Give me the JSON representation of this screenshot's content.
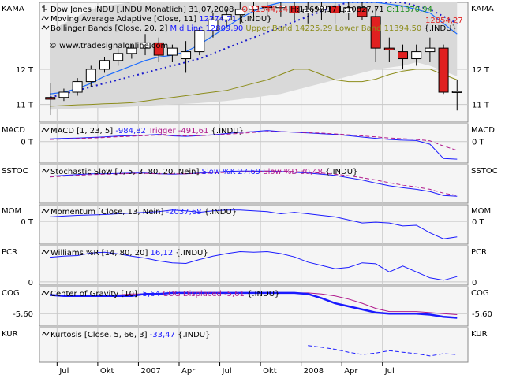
{
  "colors": {
    "bg": "#ffffff",
    "panel_bg": "#f5f5f5",
    "border": "#8a8a8a",
    "grid": "#c8c8c8",
    "band_fill": "#d9d9d9",
    "band_line": "#8c8c1a",
    "mid_line": "#1a1acc",
    "kama": "#1a6bff",
    "ma_adapt": "#1a1acc",
    "up_candle": "#ffffff",
    "down_candle": "#e02020",
    "blue": "#1a1aff",
    "purple": "#b01a8c",
    "green": "#1a8c1a",
    "red": "#e02020",
    "olive": "#8c8c1a",
    "dark": "#000000"
  },
  "chart_data": [
    {
      "id": "price",
      "type": "candlestick",
      "left_label": "KAMA",
      "right_label": "KAMA",
      "ylim": [
        10.5,
        13.9
      ],
      "yticks": [
        {
          "v": 11,
          "label": "11 T"
        },
        {
          "v": 12,
          "label": "12 T"
        }
      ],
      "legend": [
        {
          "icon": "ohlc",
          "parts": [
            {
              "t": "Dow Jones INDU [.INDU  Monatlich] 31,07,2008 - ",
              "c": "dark"
            },
            {
              "t": "O:11344,64",
              "c": "red"
            },
            {
              "t": " H:11698,17 L:10827,71 ",
              "c": "dark"
            },
            {
              "t": "C:11370,94",
              "c": "green"
            }
          ]
        },
        {
          "icon": "line",
          "parts": [
            {
              "t": "Moving Average Adaptive [Close, 11] ",
              "c": "dark"
            },
            {
              "t": "12774,71",
              "c": "blue"
            },
            {
              "t": " {.INDU}",
              "c": "dark"
            }
          ]
        },
        {
          "icon": "line",
          "parts": [
            {
              "t": "Bollinger Bands [Close, 20, 2] ",
              "c": "dark"
            },
            {
              "t": "Mid Line 12809,90",
              "c": "blue"
            },
            {
              "t": " Upper Band 14225,29 Lower Band 11394,50",
              "c": "olive"
            },
            {
              "t": " {.INDU}",
              "c": "dark"
            }
          ]
        }
      ],
      "watermark": "© www.tradesignalonline.com",
      "value_tag": "12854,27",
      "candles": [
        {
          "x": 0,
          "o": 11.2,
          "h": 11.6,
          "l": 10.7,
          "c": 11.15
        },
        {
          "x": 1,
          "o": 11.2,
          "h": 11.45,
          "l": 11.1,
          "c": 11.35
        },
        {
          "x": 2,
          "o": 11.35,
          "h": 11.75,
          "l": 11.25,
          "c": 11.65
        },
        {
          "x": 3,
          "o": 11.65,
          "h": 12.1,
          "l": 11.5,
          "c": 12.0
        },
        {
          "x": 4,
          "o": 12.0,
          "h": 12.35,
          "l": 11.9,
          "c": 12.25
        },
        {
          "x": 5,
          "o": 12.25,
          "h": 12.6,
          "l": 12.1,
          "c": 12.45
        },
        {
          "x": 6,
          "o": 12.45,
          "h": 12.7,
          "l": 12.3,
          "c": 12.6
        },
        {
          "x": 7,
          "o": 12.6,
          "h": 13.0,
          "l": 12.4,
          "c": 12.75
        },
        {
          "x": 8,
          "o": 12.75,
          "h": 12.9,
          "l": 12.2,
          "c": 12.4
        },
        {
          "x": 9,
          "o": 12.4,
          "h": 12.7,
          "l": 12.2,
          "c": 12.6
        },
        {
          "x": 10,
          "o": 12.3,
          "h": 12.8,
          "l": 11.9,
          "c": 12.5
        },
        {
          "x": 11,
          "o": 12.5,
          "h": 13.2,
          "l": 12.4,
          "c": 13.1
        },
        {
          "x": 12,
          "o": 13.1,
          "h": 13.6,
          "l": 12.9,
          "c": 13.4
        },
        {
          "x": 13,
          "o": 13.4,
          "h": 13.7,
          "l": 13.2,
          "c": 13.55
        },
        {
          "x": 14,
          "o": 13.55,
          "h": 13.9,
          "l": 13.3,
          "c": 13.7
        },
        {
          "x": 15,
          "o": 13.7,
          "h": 13.9,
          "l": 13.5,
          "c": 13.8
        },
        {
          "x": 16,
          "o": 13.8,
          "h": 13.9,
          "l": 13.5,
          "c": 13.75
        },
        {
          "x": 17,
          "o": 13.75,
          "h": 13.9,
          "l": 13.5,
          "c": 13.8
        },
        {
          "x": 18,
          "o": 13.8,
          "h": 13.9,
          "l": 13.4,
          "c": 13.6
        },
        {
          "x": 19,
          "o": 13.6,
          "h": 13.9,
          "l": 13.3,
          "c": 13.7
        },
        {
          "x": 20,
          "o": 13.7,
          "h": 13.9,
          "l": 13.4,
          "c": 13.8
        },
        {
          "x": 21,
          "o": 13.8,
          "h": 13.9,
          "l": 13.3,
          "c": 13.6
        },
        {
          "x": 22,
          "o": 13.6,
          "h": 13.9,
          "l": 13.4,
          "c": 13.75
        },
        {
          "x": 23,
          "o": 13.75,
          "h": 13.9,
          "l": 13.4,
          "c": 13.5
        },
        {
          "x": 24,
          "o": 13.5,
          "h": 13.8,
          "l": 12.2,
          "c": 12.6
        },
        {
          "x": 25,
          "o": 12.6,
          "h": 12.9,
          "l": 12.2,
          "c": 12.55
        },
        {
          "x": 26,
          "o": 12.5,
          "h": 12.7,
          "l": 12.0,
          "c": 12.3
        },
        {
          "x": 27,
          "o": 12.3,
          "h": 12.7,
          "l": 12.1,
          "c": 12.5
        },
        {
          "x": 28,
          "o": 12.5,
          "h": 12.9,
          "l": 12.2,
          "c": 12.6
        },
        {
          "x": 29,
          "o": 12.6,
          "h": 12.7,
          "l": 11.3,
          "c": 11.35
        },
        {
          "x": 30,
          "o": 11.34,
          "h": 11.7,
          "l": 10.83,
          "c": 11.37
        }
      ],
      "upper_band": [
        13.1,
        13.3,
        13.5,
        13.7,
        13.8,
        13.85,
        13.9,
        13.9,
        13.9,
        13.9,
        13.9,
        13.9,
        13.9,
        13.9,
        13.9,
        13.9,
        13.9,
        13.9,
        13.9,
        13.9,
        13.9,
        13.9,
        13.9,
        13.9,
        13.9,
        13.9,
        13.9,
        13.9,
        13.9,
        13.9,
        13.9
      ],
      "lower_band": [
        10.95,
        10.97,
        10.99,
        11.0,
        11.02,
        11.03,
        11.05,
        11.1,
        11.15,
        11.2,
        11.25,
        11.3,
        11.35,
        11.4,
        11.5,
        11.6,
        11.7,
        11.85,
        12.0,
        12.0,
        11.85,
        11.7,
        11.65,
        11.65,
        11.72,
        11.85,
        11.95,
        12.0,
        12.0,
        11.85,
        11.7
      ],
      "lower_band2": [
        10.85,
        10.87,
        10.88,
        10.9,
        10.9,
        10.92,
        10.94,
        10.96,
        10.98,
        11.0,
        11.02,
        11.04,
        11.07,
        11.1,
        11.15,
        11.2,
        11.25,
        11.3,
        11.4,
        11.5,
        11.6,
        11.7,
        11.8,
        11.9,
        12.0,
        12.05,
        12.1,
        12.2,
        12.1,
        11.95,
        11.8
      ],
      "mid_line": [
        11.2,
        11.3,
        11.4,
        11.5,
        11.6,
        11.7,
        11.8,
        11.9,
        12.0,
        12.1,
        12.2,
        12.3,
        12.45,
        12.6,
        12.75,
        12.9,
        13.05,
        13.2,
        13.35,
        13.5,
        13.65,
        13.8,
        13.9,
        13.9,
        13.9,
        13.9,
        13.9,
        13.8,
        13.7,
        13.5,
        13.3
      ],
      "kama": [
        11.3,
        11.35,
        11.45,
        11.6,
        11.8,
        11.95,
        12.1,
        12.25,
        12.35,
        12.4,
        12.5,
        12.7,
        12.95,
        13.2,
        13.45,
        13.65,
        13.8,
        13.9,
        13.9,
        13.9,
        13.9,
        13.9,
        13.9,
        13.9,
        13.9,
        13.85,
        13.8,
        13.7,
        13.6,
        13.3,
        13.0
      ]
    },
    {
      "id": "macd",
      "type": "line",
      "left_label": "MACD",
      "right_label": "MACD",
      "ylim": [
        -1200,
        1000
      ],
      "yticks": [
        {
          "v": 0,
          "label": "0 T"
        }
      ],
      "legend": [
        {
          "icon": "line",
          "parts": [
            {
              "t": "MACD [1, 23, 5] ",
              "c": "dark"
            },
            {
              "t": "-984,82",
              "c": "blue"
            },
            {
              "t": " Trigger -491,61",
              "c": "purple"
            },
            {
              "t": " {.INDU}",
              "c": "dark"
            }
          ]
        }
      ],
      "series": [
        {
          "name": "MACD",
          "color": "blue",
          "dash": false,
          "values": [
            150,
            180,
            200,
            230,
            260,
            310,
            330,
            360,
            400,
            320,
            290,
            330,
            380,
            450,
            520,
            560,
            620,
            560,
            520,
            480,
            440,
            400,
            330,
            250,
            180,
            120,
            80,
            60,
            -150,
            -950,
            -985
          ]
        },
        {
          "name": "Trigger",
          "color": "purple",
          "dash": true,
          "values": [
            120,
            140,
            170,
            200,
            230,
            270,
            300,
            330,
            360,
            340,
            320,
            330,
            360,
            410,
            460,
            510,
            560,
            550,
            530,
            500,
            470,
            430,
            380,
            320,
            260,
            200,
            160,
            120,
            40,
            -250,
            -492
          ]
        }
      ]
    },
    {
      "id": "sstoc",
      "type": "line",
      "left_label": "SSTOC",
      "right_label": "SSTOC",
      "ylim": [
        10,
        110
      ],
      "yticks": [],
      "legend": [
        {
          "icon": "line",
          "parts": [
            {
              "t": "Stochastic Slow [7, 5, 3, 80, 20, Nein] ",
              "c": "dark"
            },
            {
              "t": "Slow %K 27,69",
              "c": "blue"
            },
            {
              "t": " Slow %D 30,48",
              "c": "purple"
            },
            {
              "t": " {.INDU}",
              "c": "dark"
            }
          ]
        }
      ],
      "series": [
        {
          "name": "Slow %K",
          "color": "blue",
          "dash": false,
          "values": [
            80,
            82,
            84,
            86,
            86,
            87,
            88,
            88,
            86,
            85,
            86,
            88,
            90,
            92,
            93,
            93,
            93,
            92,
            90,
            88,
            85,
            82,
            76,
            70,
            62,
            55,
            50,
            46,
            40,
            30,
            28
          ]
        },
        {
          "name": "Slow %D",
          "color": "purple",
          "dash": true,
          "values": [
            78,
            80,
            82,
            84,
            85,
            86,
            87,
            87,
            86,
            86,
            86,
            87,
            88,
            90,
            91,
            92,
            93,
            93,
            92,
            90,
            88,
            85,
            81,
            76,
            70,
            63,
            57,
            52,
            46,
            36,
            30
          ]
        }
      ]
    },
    {
      "id": "mom",
      "type": "line",
      "left_label": "MOM",
      "right_label": "MOM",
      "ylim": [
        -3000,
        2200
      ],
      "yticks": [
        {
          "v": 0,
          "label": "0 T"
        }
      ],
      "legend": [
        {
          "icon": "line",
          "parts": [
            {
              "t": "Momentum [Close, 13, Nein] ",
              "c": "dark"
            },
            {
              "t": "-2037,68",
              "c": "blue"
            },
            {
              "t": " {.INDU}",
              "c": "dark"
            }
          ]
        }
      ],
      "series": [
        {
          "name": "Momentum",
          "color": "blue",
          "dash": false,
          "values": [
            600,
            700,
            800,
            850,
            900,
            1000,
            1100,
            1200,
            1300,
            1500,
            1400,
            1200,
            1400,
            1500,
            1500,
            1400,
            1300,
            1000,
            1200,
            1000,
            800,
            600,
            200,
            -200,
            -100,
            -200,
            -600,
            -500,
            -1500,
            -2300,
            -2038
          ]
        }
      ]
    },
    {
      "id": "pcr",
      "type": "line",
      "left_label": "PCR",
      "right_label": "PCR",
      "ylim": [
        -10,
        110
      ],
      "yticks": [
        {
          "v": 0,
          "label": "0"
        }
      ],
      "legend": [
        {
          "icon": "line",
          "parts": [
            {
              "t": "Williams %R [14, 80, 20] ",
              "c": "dark"
            },
            {
              "t": "16,12",
              "c": "blue"
            },
            {
              "t": " {.INDU}",
              "c": "dark"
            }
          ]
        }
      ],
      "series": [
        {
          "name": "Williams %R",
          "color": "blue",
          "dash": false,
          "values": [
            75,
            78,
            80,
            88,
            90,
            85,
            78,
            72,
            64,
            58,
            56,
            68,
            78,
            86,
            92,
            90,
            92,
            86,
            76,
            60,
            50,
            40,
            44,
            58,
            55,
            30,
            48,
            30,
            12,
            5,
            16
          ]
        }
      ]
    },
    {
      "id": "cog",
      "type": "line",
      "left_label": "COG",
      "right_label": "COG",
      "ylim": [
        -5.72,
        -5.34
      ],
      "yticks": [
        {
          "v": -5.6,
          "label": "-5,60"
        }
      ],
      "legend": [
        {
          "icon": "line",
          "parts": [
            {
              "t": "Center of Gravity [10] ",
              "c": "dark"
            },
            {
              "t": "-5,64",
              "c": "blue"
            },
            {
              "t": " COG Displaced -5,61",
              "c": "purple"
            },
            {
              "t": " {.INDU}",
              "c": "dark"
            }
          ]
        }
      ],
      "series": [
        {
          "name": "COG Displaced",
          "color": "purple",
          "dash": false,
          "values": [
            -5.42,
            -5.43,
            -5.43,
            -5.43,
            -5.43,
            -5.42,
            -5.41,
            -5.41,
            -5.41,
            -5.4,
            -5.4,
            -5.4,
            -5.4,
            -5.4,
            -5.4,
            -5.4,
            -5.4,
            -5.4,
            -5.4,
            -5.4,
            -5.41,
            -5.43,
            -5.46,
            -5.5,
            -5.55,
            -5.58,
            -5.58,
            -5.58,
            -5.59,
            -5.6,
            -5.61
          ]
        },
        {
          "name": "Center of Gravity",
          "color": "blue",
          "dash": false,
          "values": [
            -5.42,
            -5.43,
            -5.43,
            -5.43,
            -5.43,
            -5.43,
            -5.43,
            -5.41,
            -5.41,
            -5.4,
            -5.4,
            -5.4,
            -5.4,
            -5.4,
            -5.4,
            -5.4,
            -5.4,
            -5.4,
            -5.4,
            -5.41,
            -5.45,
            -5.5,
            -5.53,
            -5.56,
            -5.59,
            -5.6,
            -5.6,
            -5.6,
            -5.61,
            -5.63,
            -5.64
          ]
        }
      ]
    },
    {
      "id": "kur",
      "type": "line",
      "left_label": "KUR",
      "right_label": "KUR",
      "ylim": [
        -60,
        60
      ],
      "yticks": [],
      "legend": [
        {
          "icon": "line",
          "parts": [
            {
              "t": "Kurtosis [Close, 5, 66, 3] ",
              "c": "dark"
            },
            {
              "t": "-33,47",
              "c": "blue"
            },
            {
              "t": " {.INDU}",
              "c": "dark"
            }
          ]
        }
      ],
      "series": [
        {
          "name": "Kurtosis",
          "color": "blue",
          "dash": true,
          "values": [
            null,
            null,
            null,
            null,
            null,
            null,
            null,
            null,
            null,
            null,
            null,
            null,
            null,
            null,
            null,
            null,
            null,
            null,
            null,
            -2,
            -8,
            -15,
            -25,
            -33,
            -28,
            -20,
            -25,
            -30,
            -38,
            -30,
            -33
          ]
        }
      ]
    }
  ],
  "x_axis": {
    "ticks": [
      {
        "x": 0.5,
        "label": "Jul"
      },
      {
        "x": 3.5,
        "label": "Okt"
      },
      {
        "x": 6.5,
        "label": "2007"
      },
      {
        "x": 9.5,
        "label": "Apr"
      },
      {
        "x": 12.5,
        "label": "Jul"
      },
      {
        "x": 15.5,
        "label": "Okt"
      },
      {
        "x": 18.5,
        "label": "2008"
      },
      {
        "x": 21.5,
        "label": "Apr"
      },
      {
        "x": 24.5,
        "label": "Jul"
      }
    ]
  }
}
